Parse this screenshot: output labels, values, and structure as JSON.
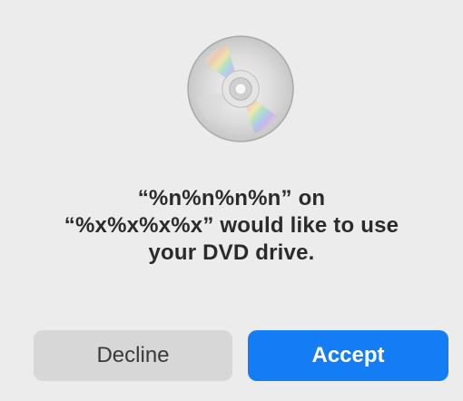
{
  "dialog": {
    "icon": "dvd-disc-icon",
    "message_lines": [
      "“%n%n%n%n” on",
      "“%x%x%x%x” would like to use",
      "your DVD drive."
    ],
    "buttons": {
      "decline_label": "Decline",
      "accept_label": "Accept"
    }
  },
  "colors": {
    "background": "#ececec",
    "accent": "#147df6",
    "secondary_button": "#d7d7d7"
  }
}
